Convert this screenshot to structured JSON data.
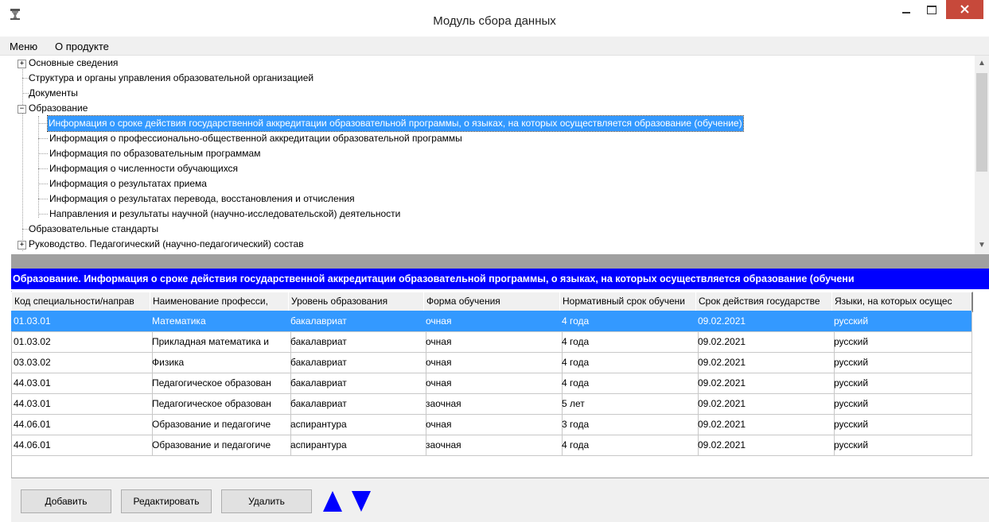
{
  "window": {
    "title": "Модуль сбора данных"
  },
  "menu": {
    "items": [
      "Меню",
      "О продукте"
    ]
  },
  "tree": {
    "items": [
      {
        "label": "Основные сведения",
        "expander": "+"
      },
      {
        "label": "Структура и органы управления образовательной организацией"
      },
      {
        "label": "Документы"
      },
      {
        "label": "Образование",
        "expander": "−"
      },
      {
        "label": "Информация о сроке действия государственной аккредитации образовательной программы, о языках, на которых осуществляется образование (обучение)",
        "selected": true
      },
      {
        "label": "Информация о профессионально-общественной аккредитации образовательной программы"
      },
      {
        "label": "Информация по образовательным программам"
      },
      {
        "label": "Информация о численности обучающихся"
      },
      {
        "label": "Информация о результатах приема"
      },
      {
        "label": "Информация о результатах перевода, восстановления и отчисления"
      },
      {
        "label": "Направления и результаты научной (научно-исследовательской) деятельности"
      },
      {
        "label": "Образовательные стандарты"
      },
      {
        "label": "Руководство. Педагогический (научно-педагогический) состав",
        "expander": "+"
      }
    ]
  },
  "banner": {
    "text": "Образование. Информация о сроке действия государственной аккредитации образовательной программы, о языках, на которых осуществляется образование (обучени"
  },
  "grid": {
    "columns": [
      "Код специальности/направ",
      "Наименование професси,",
      "Уровень образования",
      "Форма обучения",
      "Нормативный срок обучени",
      "Срок действия государстве",
      "Языки, на которых осущес"
    ],
    "rows": [
      [
        "01.03.01",
        "Математика",
        "бакалавриат",
        "очная",
        "4 года",
        "09.02.2021",
        "русский"
      ],
      [
        "01.03.02",
        "Прикладная математика и",
        "бакалавриат",
        "очная",
        "4 года",
        "09.02.2021",
        "русский"
      ],
      [
        "03.03.02",
        "Физика",
        "бакалавриат",
        "очная",
        "4 года",
        "09.02.2021",
        "русский"
      ],
      [
        "44.03.01",
        "Педагогическое образован",
        "бакалавриат",
        "очная",
        "4 года",
        "09.02.2021",
        "русский"
      ],
      [
        "44.03.01",
        "Педагогическое образован",
        "бакалавриат",
        "заочная",
        "5 лет",
        "09.02.2021",
        "русский"
      ],
      [
        "44.06.01",
        "Образование и педагогиче",
        "аспирантура",
        "очная",
        "3 года",
        "09.02.2021",
        "русский"
      ],
      [
        "44.06.01",
        "Образование и педагогиче",
        "аспирантура",
        "заочная",
        "4 года",
        "09.02.2021",
        "русский"
      ]
    ],
    "selected_row": 0
  },
  "buttons": {
    "add": "Добавить",
    "edit": "Редактировать",
    "delete": "Удалить"
  },
  "colors": {
    "selection": "#3399ff",
    "banner": "#0000ff",
    "close": "#c7493b",
    "arrow": "#0000ff"
  }
}
